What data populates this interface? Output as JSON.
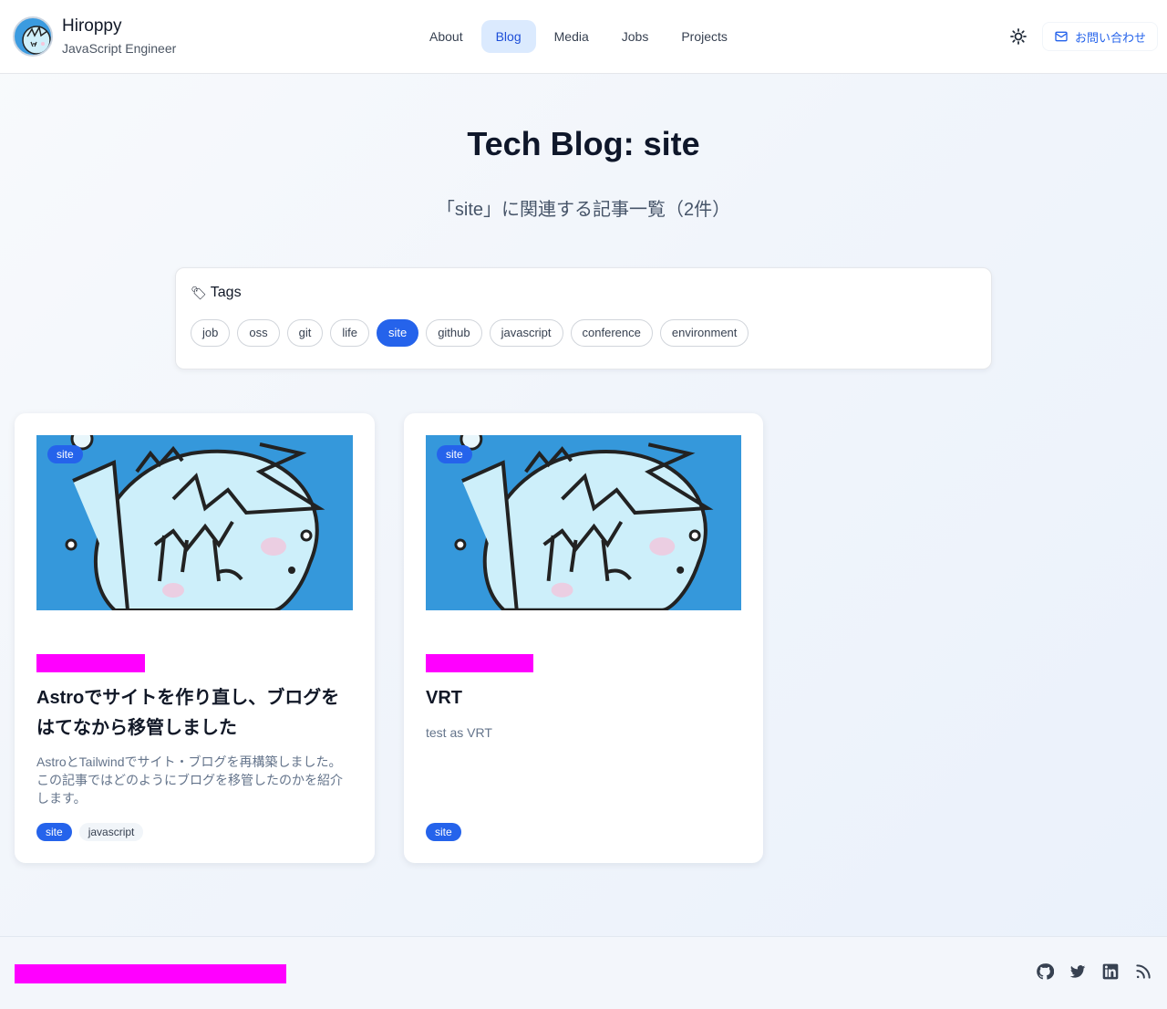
{
  "header": {
    "brand_name": "Hiroppy",
    "brand_role": "JavaScript Engineer",
    "nav": [
      {
        "label": "About",
        "active": false
      },
      {
        "label": "Blog",
        "active": true
      },
      {
        "label": "Media",
        "active": false
      },
      {
        "label": "Jobs",
        "active": false
      },
      {
        "label": "Projects",
        "active": false
      }
    ],
    "contact_label": "お問い合わせ",
    "theme_icon": "sun-icon",
    "contact_icon": "mail-icon"
  },
  "page": {
    "title": "Tech Blog: site",
    "subtitle": "「site」に関連する記事一覧（2件）"
  },
  "tags": {
    "heading": "Tags",
    "heading_icon": "🏷",
    "items": [
      "job",
      "oss",
      "git",
      "life",
      "site",
      "github",
      "javascript",
      "conference",
      "environment"
    ],
    "active": "site"
  },
  "posts": [
    {
      "badge": "site",
      "title": "Astroでサイトを作り直し、ブログをはてなから移管しました",
      "description": "AstroとTailwindでサイト・ブログを再構築しました。この記事ではどのようにブログを移管したのかを紹介します。",
      "tags": [
        "site",
        "javascript"
      ]
    },
    {
      "badge": "site",
      "title": "VRT",
      "description": "test as VRT",
      "tags": [
        "site"
      ]
    }
  ],
  "footer": {
    "social": [
      "github-icon",
      "twitter-icon",
      "linkedin-icon",
      "rss-icon"
    ]
  },
  "colors": {
    "accent": "#2563eb",
    "nav_active_bg": "#dbeafe",
    "placeholder_bar": "#ff00ff",
    "thumb_bg": "#3598db"
  }
}
